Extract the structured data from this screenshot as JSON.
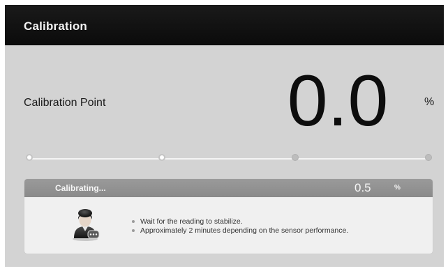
{
  "window": {
    "title": "Calibration"
  },
  "calibration": {
    "label": "Calibration Point",
    "value": "0.0",
    "unit": "%"
  },
  "progress_steps": [
    {
      "state": "done"
    },
    {
      "state": "done"
    },
    {
      "state": "pending"
    },
    {
      "state": "pending"
    }
  ],
  "panel": {
    "status": "Calibrating...",
    "value": "0.5",
    "unit": "%",
    "icon": "user-chat-icon",
    "notes": [
      "Wait for the reading to stabilize.",
      "Approximately 2 minutes depending on the sensor performance."
    ]
  }
}
